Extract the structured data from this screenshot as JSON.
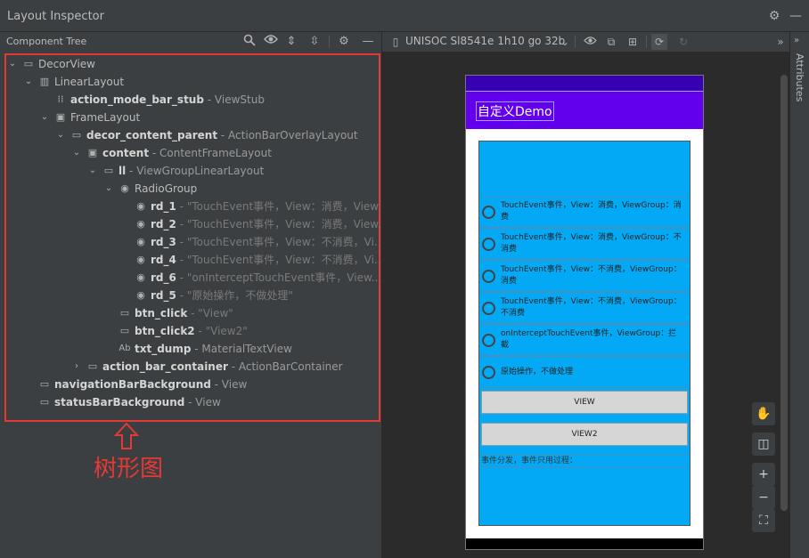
{
  "window": {
    "title": "Layout Inspector"
  },
  "panel": {
    "title": "Component Tree"
  },
  "toolbar": {
    "device": "UNISOC Sl8541e 1h10 go 32b"
  },
  "attributes_tab": {
    "label": "Attributes"
  },
  "annotation": {
    "label": "树形图"
  },
  "tree": [
    {
      "name": "DecorView",
      "sub": "",
      "str": "",
      "bold": false
    },
    {
      "name": "LinearLayout",
      "sub": "",
      "str": "",
      "bold": false
    },
    {
      "name": "action_mode_bar_stub",
      "sub": " - ViewStub",
      "str": "",
      "bold": true
    },
    {
      "name": "FrameLayout",
      "sub": "",
      "str": "",
      "bold": false
    },
    {
      "name": "decor_content_parent",
      "sub": " - ActionBarOverlayLayout",
      "str": "",
      "bold": true
    },
    {
      "name": "content",
      "sub": " - ContentFrameLayout",
      "str": "",
      "bold": true
    },
    {
      "name": "ll",
      "sub": " - ViewGroupLinearLayout",
      "str": "",
      "bold": true
    },
    {
      "name": "RadioGroup",
      "sub": "",
      "str": "",
      "bold": false
    },
    {
      "name": "rd_1",
      "sub": "",
      "str": " - \"TouchEvent事件，View：消费，View...",
      "bold": true
    },
    {
      "name": "rd_2",
      "sub": "",
      "str": " - \"TouchEvent事件，View：消费，View...",
      "bold": true
    },
    {
      "name": "rd_3",
      "sub": "",
      "str": " - \"TouchEvent事件，View：不消费，Vi...",
      "bold": true
    },
    {
      "name": "rd_4",
      "sub": "",
      "str": " - \"TouchEvent事件，View：不消费，Vi...",
      "bold": true
    },
    {
      "name": "rd_6",
      "sub": "",
      "str": " - \"onInterceptTouchEvent事件，View...",
      "bold": true
    },
    {
      "name": "rd_5",
      "sub": "",
      "str": " - \"原始操作，不做处理\"",
      "bold": true
    },
    {
      "name": "btn_click",
      "sub": "",
      "str": " - \"View\"",
      "bold": true
    },
    {
      "name": "btn_click2",
      "sub": "",
      "str": " - \"View2\"",
      "bold": true
    },
    {
      "name": "txt_dump",
      "sub": " - MaterialTextView",
      "str": "",
      "bold": true
    },
    {
      "name": "action_bar_container",
      "sub": " - ActionBarContainer",
      "str": "",
      "bold": true
    },
    {
      "name": "navigationBarBackground",
      "sub": " - View",
      "str": "",
      "bold": true
    },
    {
      "name": "statusBarBackground",
      "sub": " - View",
      "str": "",
      "bold": true
    }
  ],
  "device_preview": {
    "app_title": "自定义Demo",
    "radios": [
      "TouchEvent事件，View：消费，ViewGroup：消费",
      "TouchEvent事件，View：消费，ViewGroup：不消费",
      "TouchEvent事件，View：不消费，ViewGroup：消费",
      "TouchEvent事件，View：不消费，ViewGroup：不消费",
      "onInterceptTouchEvent事件，ViewGroup：拦截",
      "原始操作，不做处理"
    ],
    "button1": "VIEW",
    "button2": "VIEW2",
    "dump_text": "事件分发，事件只用过程："
  }
}
